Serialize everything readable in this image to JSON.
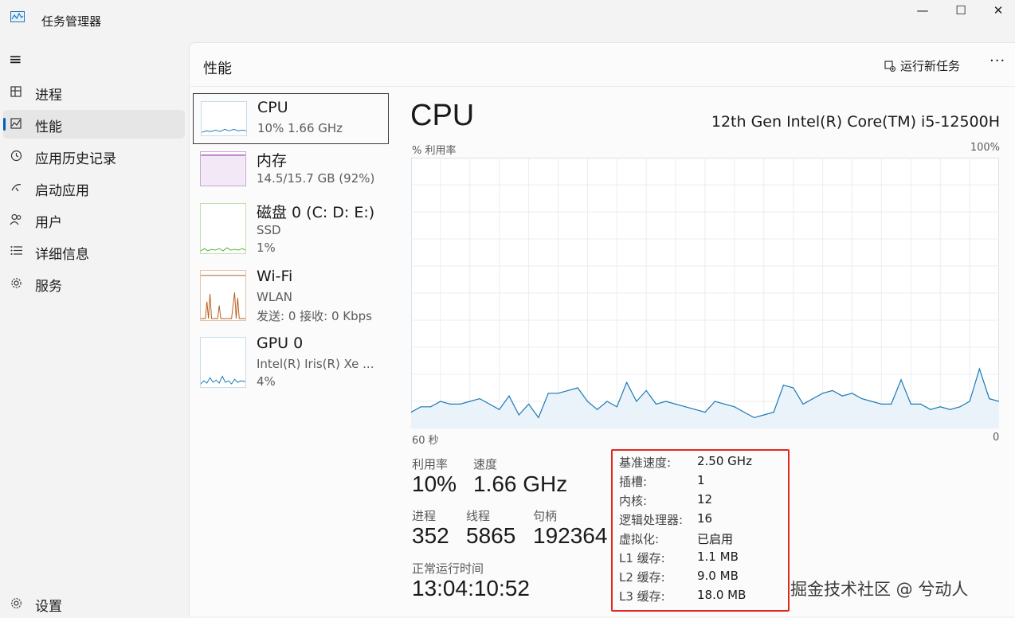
{
  "app": {
    "title": "任务管理器"
  },
  "window_controls": {
    "minimize": "—",
    "maximize": "☐",
    "close": "✕"
  },
  "sidebar": {
    "hamburger": "≡",
    "items": [
      {
        "label": "进程",
        "icon": "processes-icon",
        "active": false
      },
      {
        "label": "性能",
        "icon": "performance-icon",
        "active": true
      },
      {
        "label": "应用历史记录",
        "icon": "history-icon",
        "active": false
      },
      {
        "label": "启动应用",
        "icon": "startup-icon",
        "active": false
      },
      {
        "label": "用户",
        "icon": "users-icon",
        "active": false
      },
      {
        "label": "详细信息",
        "icon": "details-icon",
        "active": false
      },
      {
        "label": "服务",
        "icon": "services-icon",
        "active": false
      }
    ],
    "settings_label": "设置"
  },
  "header": {
    "title": "性能",
    "run_task": "运行新任务",
    "more": "···"
  },
  "devices": [
    {
      "name": "CPU",
      "sub1": "10% 1.66 GHz",
      "sub2": "",
      "selected": true,
      "color": "#1b79b3"
    },
    {
      "name": "内存",
      "sub1": "14.5/15.7 GB (92%)",
      "sub2": "",
      "selected": false,
      "color": "#8c2ea6"
    },
    {
      "name": "磁盘 0 (C: D: E:)",
      "sub1": "SSD",
      "sub2": "1%",
      "selected": false,
      "color": "#4caf2e"
    },
    {
      "name": "Wi-Fi",
      "sub1": "WLAN",
      "sub2": "发送: 0 接收: 0 Kbps",
      "selected": false,
      "color": "#b85c1a"
    },
    {
      "name": "GPU 0",
      "sub1": "Intel(R) Iris(R) Xe ...",
      "sub2": "4%",
      "selected": false,
      "color": "#1b79b3"
    }
  ],
  "cpu": {
    "heading": "CPU",
    "model": "12th Gen Intel(R) Core(TM) i5-12500H",
    "chart_label": "% 利用率",
    "chart_max": "100%",
    "chart_time": "60 秒",
    "chart_zero": "0",
    "stats": {
      "util_label": "利用率",
      "util_value": "10%",
      "speed_label": "速度",
      "speed_value": "1.66 GHz",
      "proc_label": "进程",
      "proc_value": "352",
      "thread_label": "线程",
      "thread_value": "5865",
      "handle_label": "句柄",
      "handle_value": "192364",
      "uptime_label": "正常运行时间",
      "uptime_value": "13:04:10:52"
    },
    "specs": [
      {
        "k": "基准速度:",
        "v": "2.50 GHz"
      },
      {
        "k": "插槽:",
        "v": "1"
      },
      {
        "k": "内核:",
        "v": "12"
      },
      {
        "k": "逻辑处理器:",
        "v": "16"
      },
      {
        "k": "虚拟化:",
        "v": "已启用"
      },
      {
        "k": "L1 缓存:",
        "v": "1.1 MB"
      },
      {
        "k": "L2 缓存:",
        "v": "9.0 MB"
      },
      {
        "k": "L3 缓存:",
        "v": "18.0 MB"
      }
    ]
  },
  "chart_data": {
    "type": "area",
    "title": "",
    "ylabel": "% 利用率",
    "xlabel": "60 秒",
    "ylim": [
      0,
      100
    ],
    "x": [
      60,
      59,
      58,
      57,
      56,
      55,
      54,
      53,
      52,
      51,
      50,
      49,
      48,
      47,
      46,
      45,
      44,
      43,
      42,
      41,
      40,
      39,
      38,
      37,
      36,
      35,
      34,
      33,
      32,
      31,
      30,
      29,
      28,
      27,
      26,
      25,
      24,
      23,
      22,
      21,
      20,
      19,
      18,
      17,
      16,
      15,
      14,
      13,
      12,
      11,
      10,
      9,
      8,
      7,
      6,
      5,
      4,
      3,
      2,
      1,
      0
    ],
    "series": [
      {
        "values": [
          6,
          8,
          8,
          10,
          9,
          9,
          10,
          11,
          9,
          7,
          12,
          5,
          9,
          4,
          13,
          13,
          14,
          15,
          10,
          7,
          10,
          8,
          17,
          10,
          14,
          9,
          10,
          9,
          8,
          7,
          6,
          10,
          9,
          8,
          6,
          4,
          5,
          6,
          16,
          15,
          9,
          11,
          13,
          14,
          12,
          13,
          11,
          10,
          9,
          9,
          18,
          9,
          9,
          7,
          8,
          7,
          8,
          10,
          22,
          11,
          10
        ]
      }
    ],
    "grid": true,
    "color": "#1b79b3"
  }
}
